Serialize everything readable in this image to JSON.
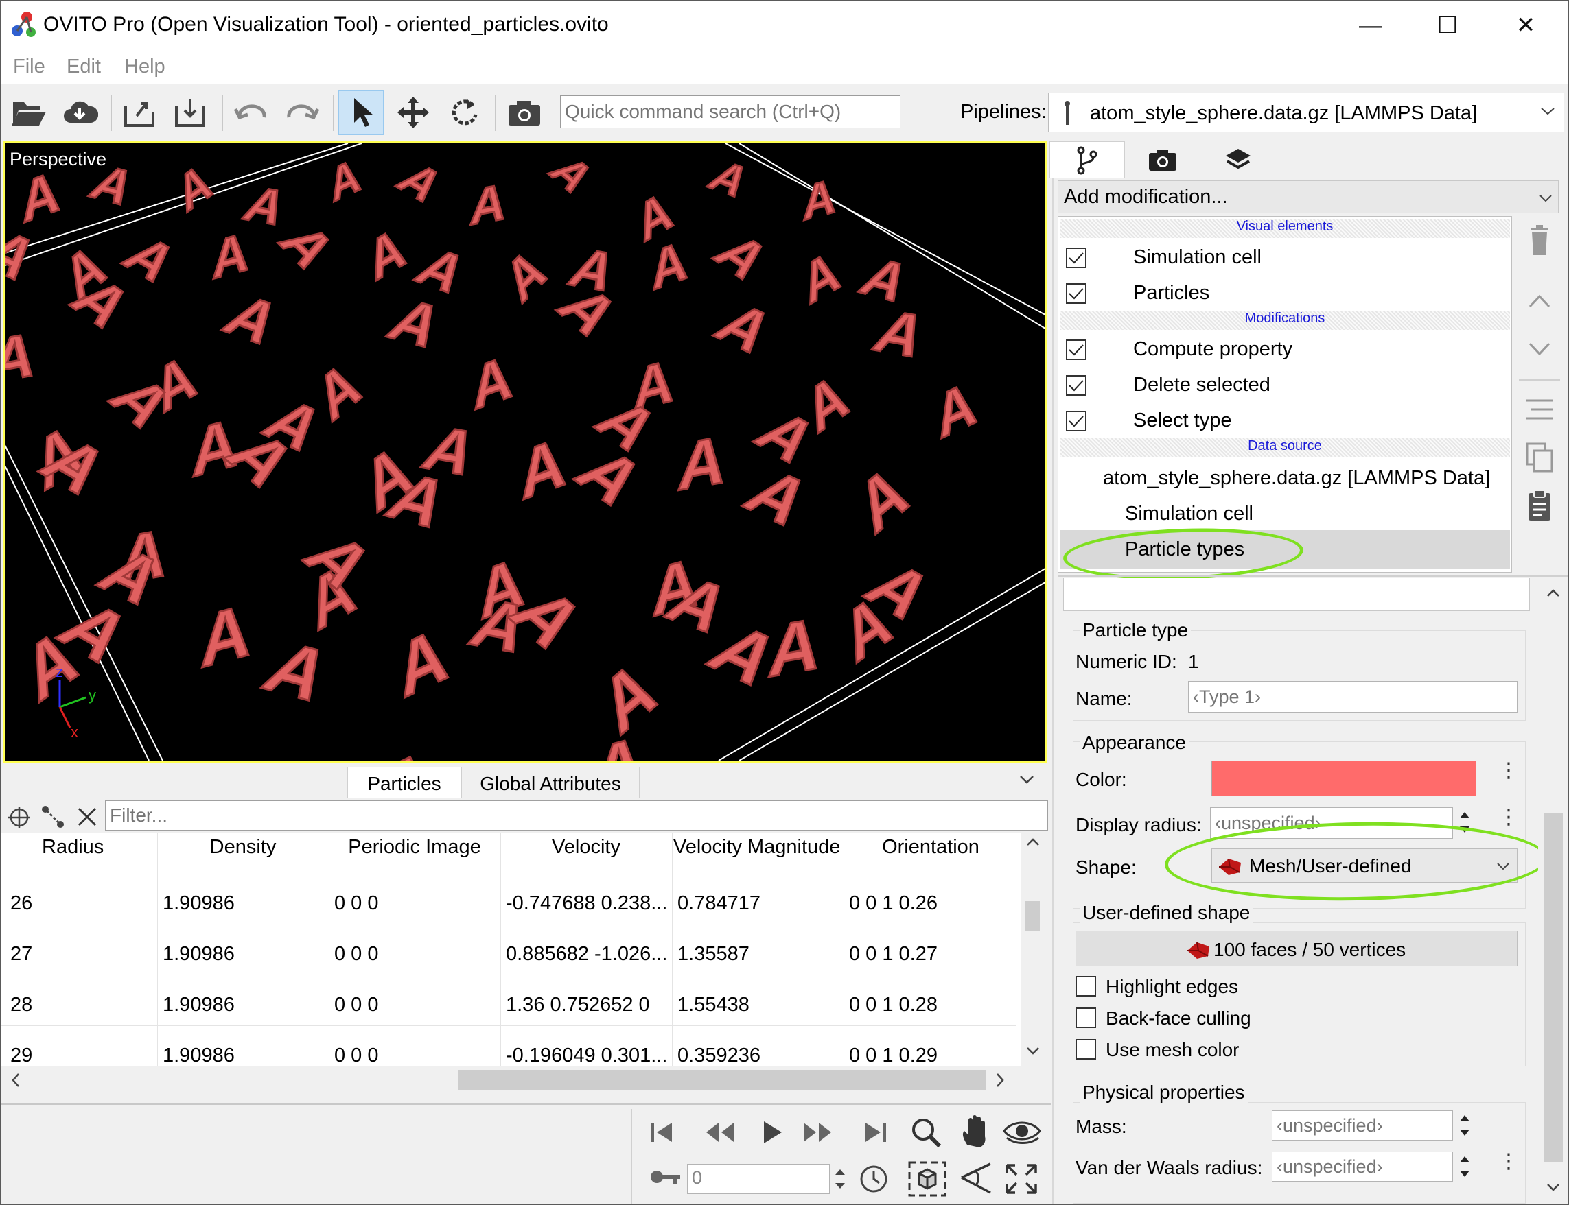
{
  "window": {
    "title": "OVITO Pro (Open Visualization Tool) - oriented_particles.ovito",
    "minimize": "—",
    "maximize": "☐",
    "close": "✕"
  },
  "menu": {
    "file": "File",
    "edit": "Edit",
    "help": "Help"
  },
  "toolbar": {
    "search_placeholder": "Quick command search (Ctrl+Q)",
    "pipelines_label": "Pipelines:",
    "pipeline_selected": "atom_style_sphere.data.gz [LAMMPS Data]"
  },
  "viewport": {
    "label": "Perspective",
    "axis_z": "z",
    "axis_y": "y",
    "axis_x": "x",
    "glyph": "A",
    "glyph_color": "#e06060"
  },
  "data_inspector": {
    "tabs": [
      "Particles",
      "Global Attributes"
    ],
    "filter_placeholder": "Filter...",
    "columns": [
      "Radius",
      "Density",
      "Periodic Image",
      "Velocity",
      "Velocity Magnitude",
      "Orientation"
    ],
    "rows": [
      {
        "index": "26",
        "radius": "",
        "density": "1.90986",
        "periodic": "0 0 0",
        "velocity": "-0.747688 0.238...",
        "vmag": "0.784717",
        "orientation": "0 0 1 0.26"
      },
      {
        "index": "27",
        "radius": "",
        "density": "1.90986",
        "periodic": "0 0 0",
        "velocity": "0.885682 -1.026...",
        "vmag": "1.35587",
        "orientation": "0 0 1 0.27"
      },
      {
        "index": "28",
        "radius": "",
        "density": "1.90986",
        "periodic": "0 0 0",
        "velocity": "1.36 0.752652 0",
        "vmag": "1.55438",
        "orientation": "0 0 1 0.28"
      },
      {
        "index": "29",
        "radius": "",
        "density": "1.90986",
        "periodic": "0 0 0",
        "velocity": "-0.196049 0.301...",
        "vmag": "0.359236",
        "orientation": "0 0 1 0.29"
      }
    ]
  },
  "animation": {
    "frame": "0"
  },
  "pipeline_editor": {
    "add_modification": "Add modification...",
    "sections": {
      "visual": "Visual elements",
      "modifications": "Modifications",
      "source": "Data source"
    },
    "visual_items": [
      "Simulation cell",
      "Particles"
    ],
    "modifications": [
      "Compute property",
      "Delete selected",
      "Select type"
    ],
    "source": "atom_style_sphere.data.gz [LAMMPS Data]",
    "source_children": [
      "Simulation cell",
      "Particle types"
    ]
  },
  "properties": {
    "particle_type_group": "Particle type",
    "numeric_id_label": "Numeric ID:",
    "numeric_id": "1",
    "name_label": "Name:",
    "name_placeholder": "‹Type 1›",
    "appearance_group": "Appearance",
    "color_label": "Color:",
    "color_value": "#ff6b6b",
    "radius_label": "Display radius:",
    "radius_placeholder": "‹unspecified›",
    "shape_label": "Shape:",
    "shape_value": "Mesh/User-defined",
    "user_shape_group": "User-defined shape",
    "mesh_info": "100 faces / 50 vertices",
    "highlight_edges": "Highlight edges",
    "backface_culling": "Back-face culling",
    "use_mesh_color": "Use mesh color",
    "physical_group": "Physical properties",
    "mass_label": "Mass:",
    "mass_placeholder": "‹unspecified›",
    "vdw_label": "Van der Waals radius:",
    "vdw_placeholder": "‹unspecified›"
  },
  "highlight_color": "#7fe020"
}
